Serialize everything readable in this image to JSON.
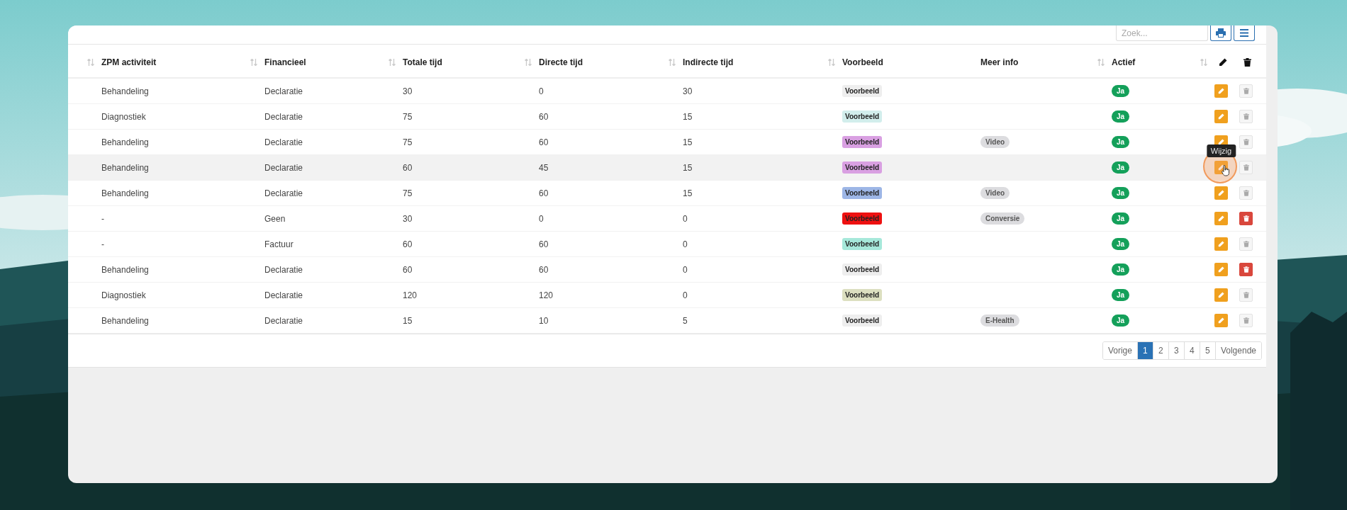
{
  "toolbar": {
    "search": {
      "placeholder": "Zoek..."
    }
  },
  "table": {
    "columns": [
      {
        "kind": "blank",
        "sortable": true
      },
      {
        "kind": "text",
        "label": "ZPM activiteit",
        "sortable": true
      },
      {
        "kind": "text",
        "label": "Financieel",
        "sortable": true
      },
      {
        "kind": "text",
        "label": "Totale tijd",
        "sortable": true
      },
      {
        "kind": "text",
        "label": "Directe tijd",
        "sortable": true
      },
      {
        "kind": "text",
        "label": "Indirecte tijd",
        "sortable": true
      },
      {
        "kind": "text",
        "label": "Voorbeeld",
        "sortable": false
      },
      {
        "kind": "text",
        "label": "Meer info",
        "sortable": true
      },
      {
        "kind": "text",
        "label": "Actief",
        "sortable": true
      },
      {
        "kind": "edit"
      },
      {
        "kind": "delete"
      }
    ],
    "rows": [
      {
        "zpm": "Behandeling",
        "financieel": "Declaratie",
        "totaal": "30",
        "direct": "0",
        "indirect": "30",
        "voorbeeld": {
          "label": "Voorbeeld",
          "color": "#eeeeee"
        },
        "actief": "Ja",
        "hovered": false,
        "delete_enabled": false
      },
      {
        "zpm": "Diagnostiek",
        "financieel": "Declaratie",
        "totaal": "75",
        "direct": "60",
        "indirect": "15",
        "voorbeeld": {
          "label": "Voorbeeld",
          "color": "#d2eeec"
        },
        "actief": "Ja",
        "hovered": false,
        "delete_enabled": false
      },
      {
        "zpm": "Behandeling",
        "financieel": "Declaratie",
        "totaal": "75",
        "direct": "60",
        "indirect": "15",
        "voorbeeld": {
          "label": "Voorbeeld",
          "color": "#d9a0e2"
        },
        "meer_info": "Video",
        "actief": "Ja",
        "hovered": false,
        "delete_enabled": false
      },
      {
        "zpm": "Behandeling",
        "financieel": "Declaratie",
        "totaal": "60",
        "direct": "45",
        "indirect": "15",
        "voorbeeld": {
          "label": "Voorbeeld",
          "color": "#d9a0e2"
        },
        "actief": "Ja",
        "hovered": true,
        "delete_enabled": false,
        "edit_tooltip": "Wijzig"
      },
      {
        "zpm": "Behandeling",
        "financieel": "Declaratie",
        "totaal": "75",
        "direct": "60",
        "indirect": "15",
        "voorbeeld": {
          "label": "Voorbeeld",
          "color": "#9db6e6"
        },
        "meer_info": "Video",
        "actief": "Ja",
        "hovered": false,
        "delete_enabled": false
      },
      {
        "zpm": "-",
        "financieel": "Geen",
        "totaal": "30",
        "direct": "0",
        "indirect": "0",
        "voorbeeld": {
          "label": "Voorbeeld",
          "color": "#ee1111"
        },
        "meer_info": "Conversie",
        "actief": "Ja",
        "hovered": false,
        "delete_enabled": true
      },
      {
        "zpm": "-",
        "financieel": "Factuur",
        "totaal": "60",
        "direct": "60",
        "indirect": "0",
        "voorbeeld": {
          "label": "Voorbeeld",
          "color": "#a6e8da"
        },
        "actief": "Ja",
        "hovered": false,
        "delete_enabled": false
      },
      {
        "zpm": "Behandeling",
        "financieel": "Declaratie",
        "totaal": "60",
        "direct": "60",
        "indirect": "0",
        "voorbeeld": {
          "label": "Voorbeeld",
          "color": "#eeeeee"
        },
        "actief": "Ja",
        "hovered": false,
        "delete_enabled": true
      },
      {
        "zpm": "Diagnostiek",
        "financieel": "Declaratie",
        "totaal": "120",
        "direct": "120",
        "indirect": "0",
        "voorbeeld": {
          "label": "Voorbeeld",
          "color": "#dcdfc0"
        },
        "actief": "Ja",
        "hovered": false,
        "delete_enabled": false
      },
      {
        "zpm": "Behandeling",
        "financieel": "Declaratie",
        "totaal": "15",
        "direct": "10",
        "indirect": "5",
        "voorbeeld": {
          "label": "Voorbeeld",
          "color": "#eeeeee"
        },
        "meer_info": "E-Health",
        "actief": "Ja",
        "hovered": false,
        "delete_enabled": false
      }
    ]
  },
  "pagination": {
    "previous": "Vorige",
    "pages": [
      {
        "label": "1",
        "selected": true
      },
      {
        "label": "2",
        "selected": false
      },
      {
        "label": "3",
        "selected": false
      },
      {
        "label": "4",
        "selected": false
      },
      {
        "label": "5",
        "selected": false
      }
    ],
    "next": "Volgende"
  }
}
